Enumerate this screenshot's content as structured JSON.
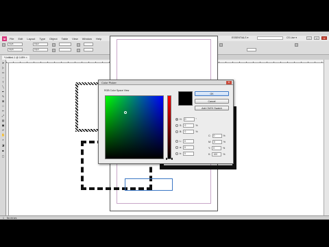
{
  "app": {
    "icon_label": "Id"
  },
  "menu": [
    "File",
    "Edit",
    "Layout",
    "Type",
    "Object",
    "Table",
    "View",
    "Window",
    "Help"
  ],
  "workspace": {
    "name": "ESSENTIALS ▾",
    "cs_live": "CS Live ▾"
  },
  "controlbar": {
    "zoom": "145",
    "stroke_weight": "0 pt",
    "opacity": "100%",
    "x": "11p6",
    "y": "12p6",
    "w": "13p2",
    "h": "13p3"
  },
  "document_tab": "*Untitled-1 @ 145% ×",
  "status": {
    "page": "1",
    "info": "No errors"
  },
  "dialog": {
    "title": "Color Picker",
    "close": "✕",
    "space_label": "RGB Color Space View",
    "buttons": {
      "ok": "OK",
      "cancel": "Cancel",
      "add_swatch": "Add CMYK Swatch"
    },
    "fields": [
      {
        "label": "H:",
        "value": "0",
        "unit": "°",
        "selected": true
      },
      {
        "label": "S:",
        "value": "0",
        "unit": "%",
        "selected": false
      },
      {
        "label": "B:",
        "value": "0",
        "unit": "%",
        "selected": false
      },
      {
        "label": "L:",
        "value": "0",
        "unit": "",
        "selected": false
      },
      {
        "label": "a:",
        "value": "0",
        "unit": "",
        "selected": false
      },
      {
        "label": "b:",
        "value": "0",
        "unit": "",
        "selected": false
      },
      {
        "label": "C:",
        "value": "0",
        "unit": "%",
        "selected": false
      },
      {
        "label": "M:",
        "value": "0",
        "unit": "%",
        "selected": false
      },
      {
        "label": "Y:",
        "value": "0",
        "unit": "%",
        "selected": false
      },
      {
        "label": "K:",
        "value": "100",
        "unit": "%",
        "selected": false
      }
    ],
    "current_color": "#000000"
  },
  "colors": {
    "accent": "#3a76c4",
    "close": "#c94b3c",
    "app_icon": "#d7377c"
  }
}
